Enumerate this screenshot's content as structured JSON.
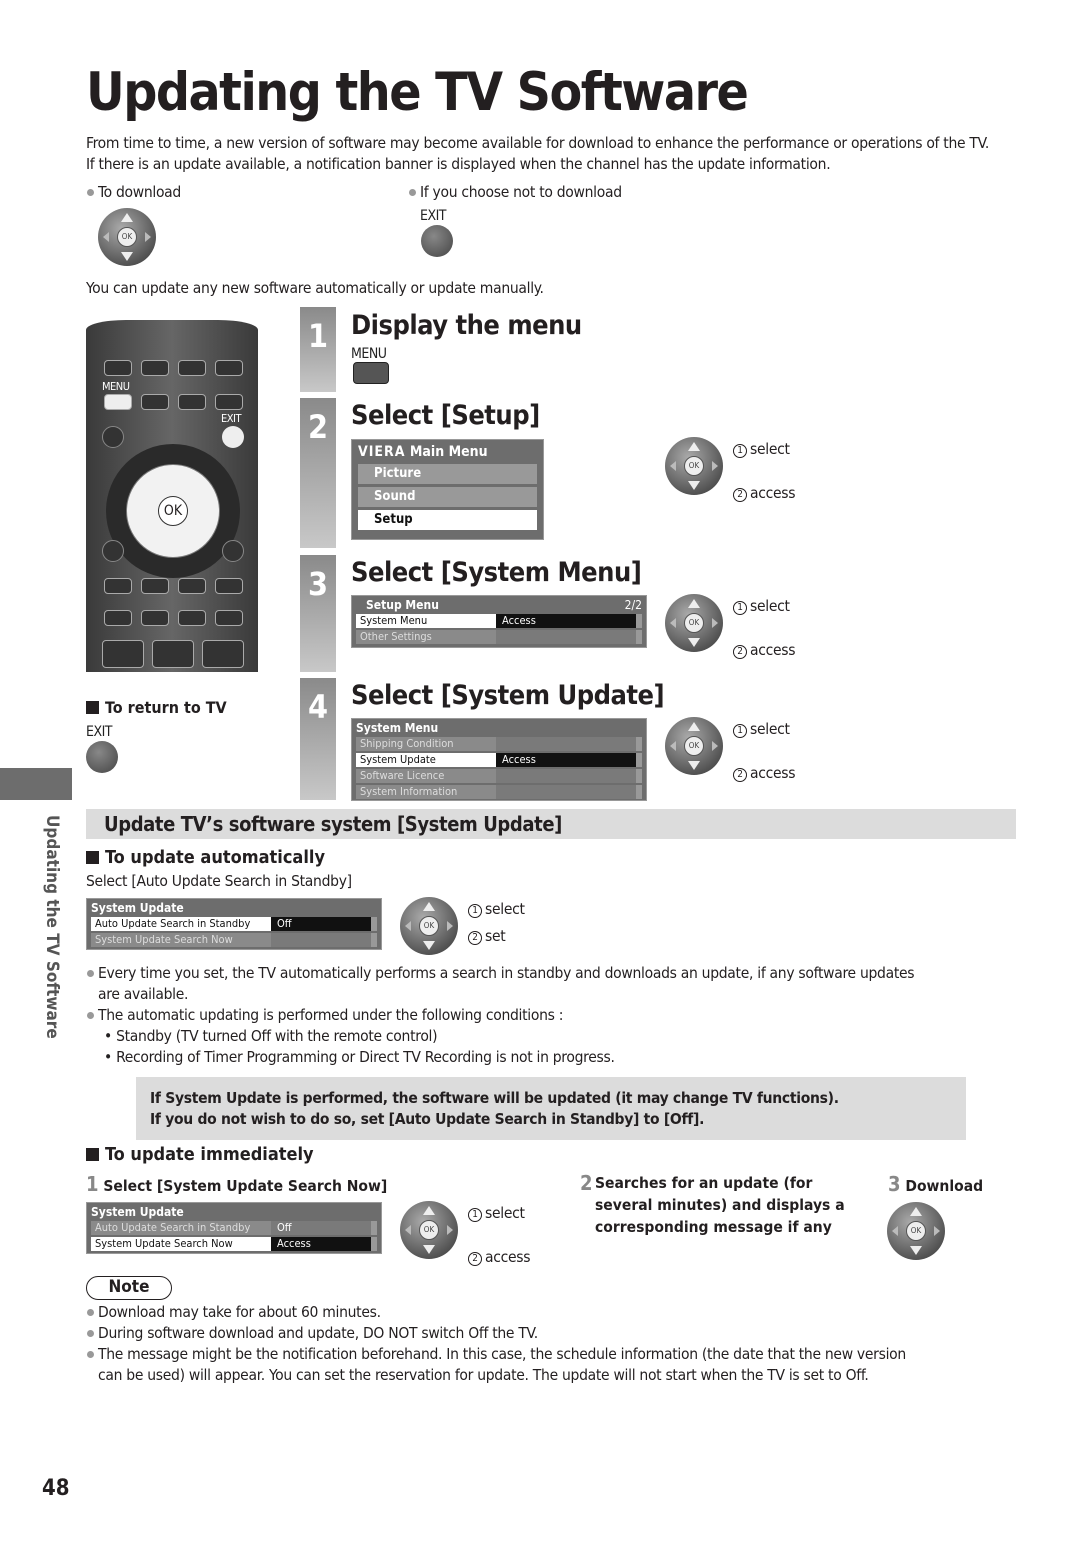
{
  "title": "Updating the TV Software",
  "intro": [
    "From time to time, a new version of software may become available for download to enhance the performance or operations of the TV.",
    "If there is an update available, a notification banner is displayed when the channel has the update information."
  ],
  "to_download": "To download",
  "not_download": "If you choose not to download",
  "exit_label": "EXIT",
  "ok_label": "OK",
  "auto_or_manual": "You can update any new software automatically or update manually.",
  "remote": {
    "menu_label": "MENU",
    "exit_label": "EXIT",
    "ok_label": "OK"
  },
  "return_tv": {
    "heading": "To return to TV",
    "exit_label": "EXIT"
  },
  "steps": [
    {
      "num": "1",
      "title": "Display the menu",
      "button_label": "MENU"
    },
    {
      "num": "2",
      "title": "Select [Setup]",
      "menu": {
        "logo": "VIERA",
        "header": "Main Menu",
        "items": [
          "Picture",
          "Sound",
          "Setup"
        ],
        "selected": "Setup"
      },
      "select": "select",
      "access": "access"
    },
    {
      "num": "3",
      "title": "Select [System Menu]",
      "menu": {
        "header": "Setup Menu",
        "page": "2/2",
        "rows": [
          {
            "k": "System Menu",
            "v": "Access"
          },
          {
            "k": "Other Settings",
            "v": ""
          }
        ]
      },
      "select": "select",
      "access": "access"
    },
    {
      "num": "4",
      "title": "Select [System Update]",
      "menu": {
        "header": "System Menu",
        "rows": [
          {
            "k": "Shipping Condition",
            "v": ""
          },
          {
            "k": "System Update",
            "v": "Access"
          },
          {
            "k": "Software Licence",
            "v": ""
          },
          {
            "k": "System Information",
            "v": ""
          }
        ]
      },
      "select": "select",
      "access": "access"
    }
  ],
  "side_tab": "Updating the TV Software",
  "section_title": "Update TV’s software system [System Update]",
  "auto": {
    "heading": "To update automatically",
    "instruction": "Select [Auto Update Search in Standby]",
    "menu": {
      "header": "System Update",
      "rows": [
        {
          "k": "Auto Update Search in Standby",
          "v": "Off"
        },
        {
          "k": "System Update Search Now",
          "v": ""
        }
      ]
    },
    "select": "select",
    "set": "set",
    "bullets": [
      "Every time you set, the TV automatically performs a search in standby and downloads an update, if any software updates",
      "are available.",
      "The automatic updating is performed under the following conditions :"
    ],
    "conditions": [
      "Standby (TV turned Off with the remote control)",
      "Recording of Timer Programming or Direct TV Recording is not in progress."
    ]
  },
  "warning": [
    "If System Update is performed, the software will be updated (it may change TV functions).",
    "If you do not wish to do so, set [Auto Update Search in Standby] to [Off]."
  ],
  "immediate": {
    "heading": "To update immediately",
    "step1": {
      "num": "1",
      "text": "Select [System Update Search Now]",
      "menu": {
        "header": "System Update",
        "rows": [
          {
            "k": "Auto Update Search in Standby",
            "v": "Off"
          },
          {
            "k": "System Update Search Now",
            "v": "Access"
          }
        ]
      },
      "select": "select",
      "access": "access"
    },
    "step2": {
      "num": "2",
      "lines": [
        "Searches for an update (for",
        "several minutes) and displays a",
        "corresponding message if any"
      ]
    },
    "step3": {
      "num": "3",
      "text": "Download"
    }
  },
  "note": {
    "label": "Note",
    "bullets": [
      "Download may take for about 60 minutes.",
      "During software download and update, DO NOT switch Off the TV.",
      "The message might be the notification beforehand. In this case, the schedule information (the date that the new version",
      "can be used) will appear. You can set the reservation for update. The update will not start when the TV is set to Off."
    ]
  },
  "page_number": "48"
}
